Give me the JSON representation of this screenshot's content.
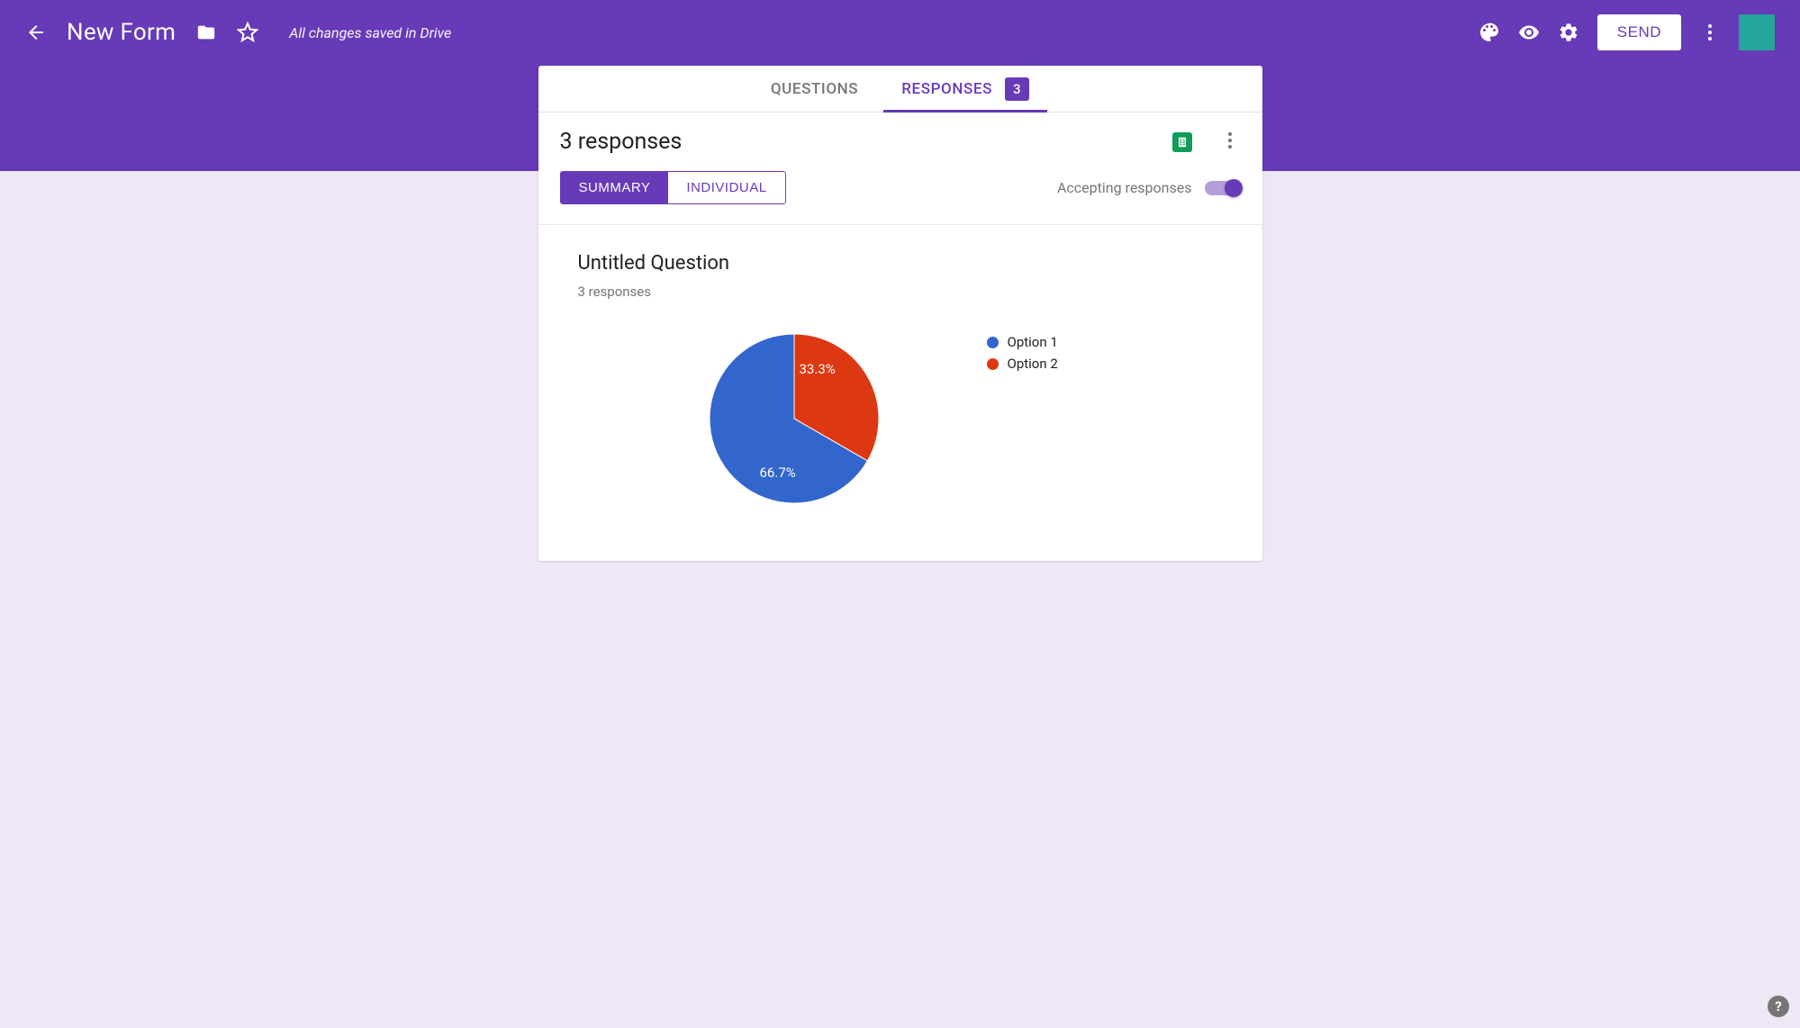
{
  "header": {
    "title": "New Form",
    "save_status": "All changes saved in Drive",
    "send_label": "SEND"
  },
  "tabs": {
    "questions_label": "QUESTIONS",
    "responses_label": "RESPONSES",
    "responses_badge": "3"
  },
  "responses": {
    "heading": "3 responses",
    "view_summary": "SUMMARY",
    "view_individual": "INDIVIDUAL",
    "accepting_label": "Accepting responses",
    "accepting_on": true
  },
  "question": {
    "title": "Untitled Question",
    "subtitle": "3 responses"
  },
  "chart_data": {
    "type": "pie",
    "title": "Untitled Question",
    "legend_position": "right",
    "series": [
      {
        "name": "Option 1",
        "value": 66.7,
        "label": "66.7%",
        "color": "#3366CC"
      },
      {
        "name": "Option 2",
        "value": 33.3,
        "label": "33.3%",
        "color": "#DC3912"
      }
    ]
  }
}
